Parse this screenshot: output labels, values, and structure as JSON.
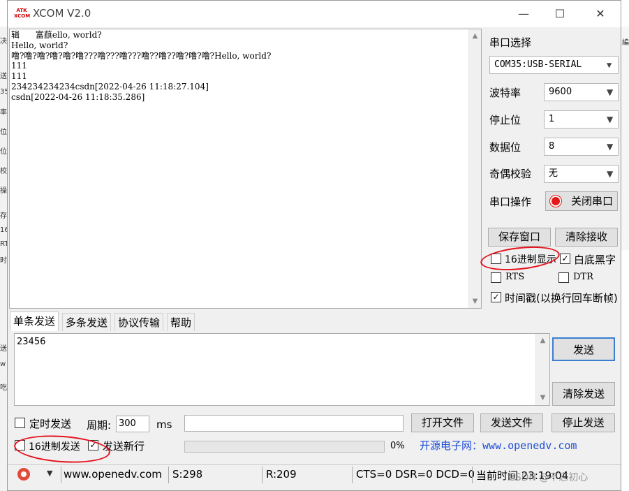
{
  "background_window": {
    "edge_fragments": [
      "决",
      "送",
      "35",
      "率",
      "位",
      "位",
      "校",
      "操",
      "存",
      "16",
      "RTS",
      "时",
      "送",
      "w",
      "吃"
    ],
    "right_fragment": "編"
  },
  "window": {
    "title": "XCOM V2.0",
    "logo_text": "ATK XCOM",
    "minimize": "—",
    "maximize": "☐",
    "close": "✕"
  },
  "receive": {
    "lines": [
      "辑      富蕻ello, world?",
      "Hello, world?",
      "噜?噜?噜?噜?噜?噜???噜???噜???噜??噜??噜?噜?噜?Hello, world?",
      "111",
      "111",
      "234234234234csdn[2022-04-26 11:18:27.104]",
      "csdn[2022-04-26 11:18:35.286]"
    ]
  },
  "serial": {
    "port_label": "串口选择",
    "port_value": "COM35:USB-SERIAL",
    "baud_label": "波特率",
    "baud_value": "9600",
    "stop_label": "停止位",
    "stop_value": "1",
    "data_label": "数据位",
    "data_value": "8",
    "parity_label": "奇偶校验",
    "parity_value": "无",
    "op_label": "串口操作",
    "op_button": "关闭串口",
    "save_window": "保存窗口",
    "clear_receive": "清除接收",
    "hex_display": "16进制显示",
    "white_bg": "白底黑字",
    "rts": "RTS",
    "dtr": "DTR",
    "timestamp": "时间戳(以换行回车断帧)",
    "hex_display_checked": false,
    "white_bg_checked": true,
    "rts_checked": false,
    "dtr_checked": false,
    "timestamp_checked": true
  },
  "tabs": [
    "单条发送",
    "多条发送",
    "协议传输",
    "帮助"
  ],
  "send": {
    "text": "23456",
    "send_button": "发送",
    "clear_send": "清除发送",
    "timed_send": "定时发送",
    "period_label": "周期:",
    "period_value": "300",
    "period_unit": "ms",
    "open_file": "打开文件",
    "send_file": "发送文件",
    "stop_send": "停止发送",
    "hex_send": "16进制发送",
    "newline": "发送新行",
    "progress": "0%",
    "progress_value": 0,
    "ad_link": "开源电子网：www.openedv.com",
    "timed_checked": false,
    "hex_send_checked": false,
    "newline_checked": true
  },
  "status": {
    "url": "www.openedv.com",
    "sent": "S:298",
    "received": "R:209",
    "signals": "CTS=0 DSR=0 DCD=0",
    "time": "当前时间 23:19:04",
    "watermark": "CSDN @不忘初心"
  },
  "colors": {
    "annotation_red": "#e5101b",
    "link_blue": "#1f4fd6",
    "focus_blue": "#3c7fd1",
    "record_red": "#e41a1a"
  }
}
